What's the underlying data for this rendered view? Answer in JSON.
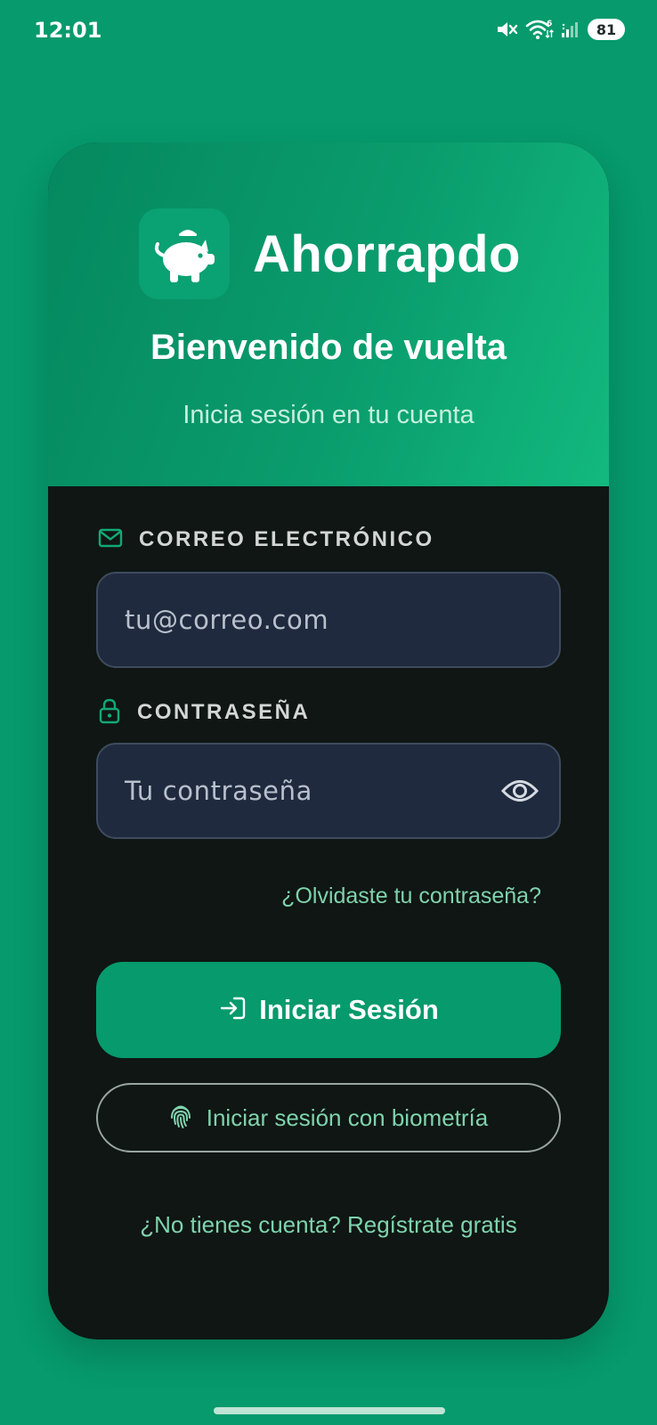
{
  "status_bar": {
    "time": "12:01",
    "wifi_badge": "6",
    "battery": "81"
  },
  "app": {
    "name": "Ahorrapdo",
    "logo_icon": "piggy-bank-icon",
    "welcome": "Bienvenido de vuelta",
    "subtitle": "Inicia sesión en tu cuenta"
  },
  "form": {
    "email": {
      "label": "CORREO ELECTRÓNICO",
      "icon": "mail-icon",
      "placeholder": "tu@correo.com",
      "value": ""
    },
    "password": {
      "label": "CONTRASEÑA",
      "icon": "lock-icon",
      "placeholder": "Tu contraseña",
      "value": "",
      "toggle_icon": "eye-icon"
    },
    "forgot_link": "¿Olvidaste tu contraseña?",
    "login_button": "Iniciar Sesión",
    "biometric_button": "Iniciar sesión con biometría",
    "register_link": "¿No tienes cuenta? Regístrate gratis"
  },
  "colors": {
    "background": "#069a6c",
    "card_body": "#0f1614",
    "accent": "#069a6c",
    "link": "#7fd3ac",
    "input_bg": "#1f2a3e"
  }
}
